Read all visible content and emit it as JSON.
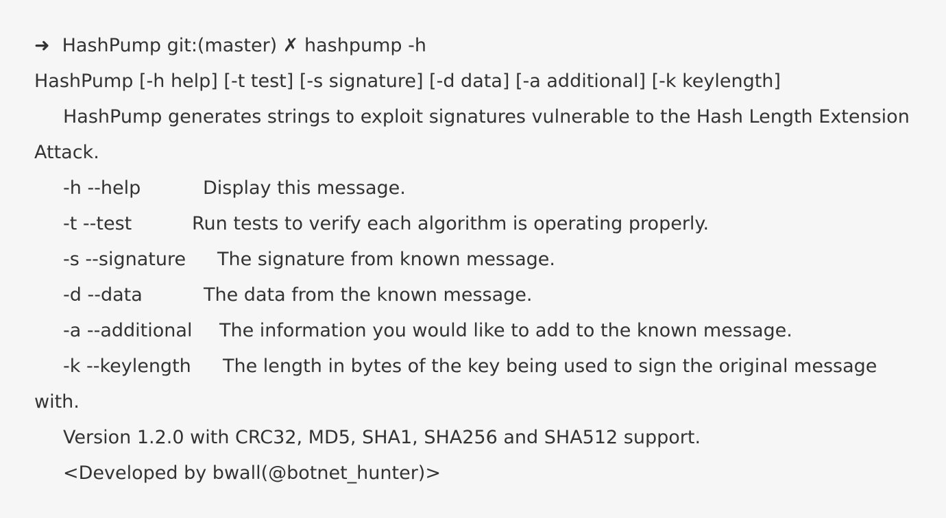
{
  "prompt": {
    "arrow": "➜",
    "command_line": "HashPump git:(master) ✗ hashpump -h"
  },
  "usage": "HashPump [-h help] [-t test] [-s signature] [-d data] [-a additional] [-k keylength]",
  "description": {
    "line1": "HashPump generates strings to exploit signatures vulnerable to the Hash Length Extension",
    "line2": "Attack."
  },
  "options": [
    {
      "flag": "-h --help",
      "desc": "Display this message."
    },
    {
      "flag": "-t --test",
      "desc": "Run tests to verify each algorithm is operating properly."
    },
    {
      "flag": "-s --signature",
      "desc": "The signature from known message."
    },
    {
      "flag": "-d --data",
      "desc": "The data from the known message."
    },
    {
      "flag": "-a --additional",
      "desc": "The information you would like to add to the known message."
    },
    {
      "flag": "-k --keylength",
      "desc": "The length in bytes of the key being used to sign the original message"
    }
  ],
  "keylength_wrap": "with.",
  "version": "Version 1.2.0 with CRC32, MD5, SHA1, SHA256 and SHA512 support.",
  "developer": "<Developed by bwall(@botnet_hunter)>"
}
